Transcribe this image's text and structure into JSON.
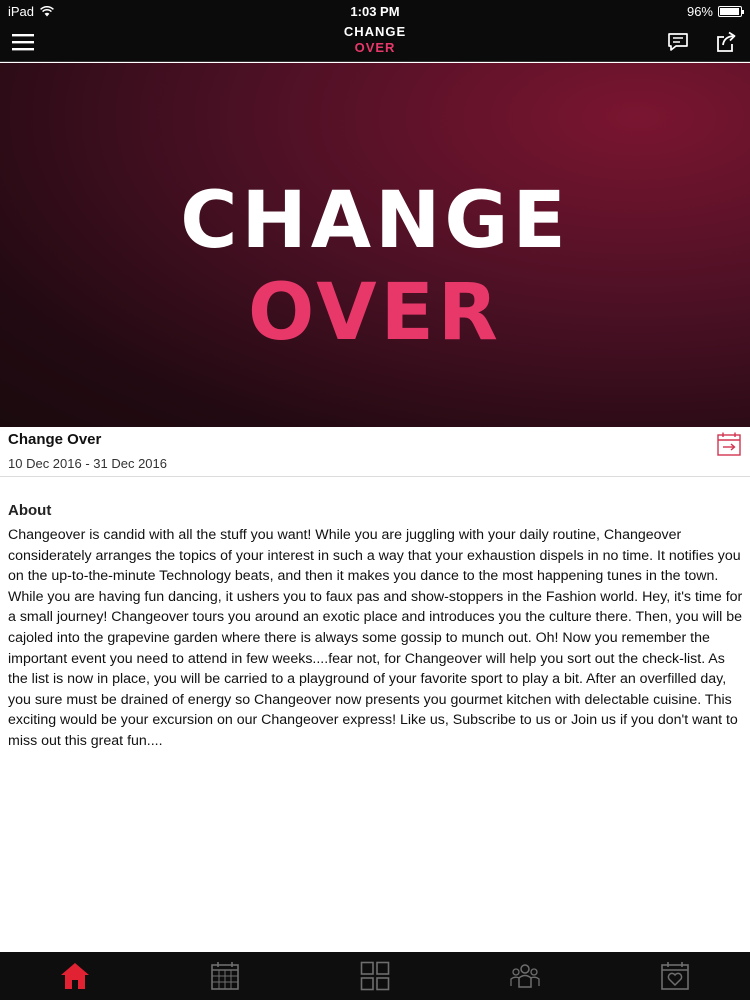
{
  "status": {
    "device": "iPad",
    "time": "1:03 PM",
    "battery": "96%",
    "battery_level": 0.96
  },
  "logo": {
    "line1": "CHANGE",
    "line2": "OVER"
  },
  "event": {
    "title": "Change Over",
    "dates": "10 Dec 2016 - 31 Dec 2016"
  },
  "about": {
    "heading": "About",
    "text": "Changeover is candid with all the stuff you want! While you are juggling with your daily routine, Changeover considerately arranges the topics of your interest in such a way that your exhaustion dispels in no time. It notifies you on the up-to-the-minute Technology beats, and then it makes you dance to the most happening tunes in the town. While you are having fun dancing, it ushers you to faux pas and show-stoppers in the Fashion world. Hey, it's time for a small journey! Changeover tours you around an exotic place and introduces you the culture there. Then, you will be cajoled into the grapevine garden where there is always some gossip to munch out. Oh! Now you remember the important event you need to attend in few weeks....fear not, for Changeover will help you sort out the check-list. As the list is now in place, you will be carried to a playground of your favorite sport to play a bit. After an overfilled day, you sure must be drained of energy so Changeover now presents you gourmet kitchen with delectable cuisine. This exciting would be your excursion on our Changeover express! Like us, Subscribe to us or Join us if you don't want to miss out this great fun...."
  },
  "icons": {
    "menu": "hamburger-menu-icon",
    "comment": "comment-icon",
    "share": "share-icon",
    "calendar_add": "calendar-add-icon",
    "tabs": [
      "home-icon",
      "calendar-icon",
      "grid-icon",
      "people-icon",
      "heart-calendar-icon"
    ]
  },
  "colors": {
    "accent": "#e8386a",
    "bar": "#0b0b0b",
    "tab_active": "#e02233",
    "tab_inactive": "#6e6e6e"
  }
}
